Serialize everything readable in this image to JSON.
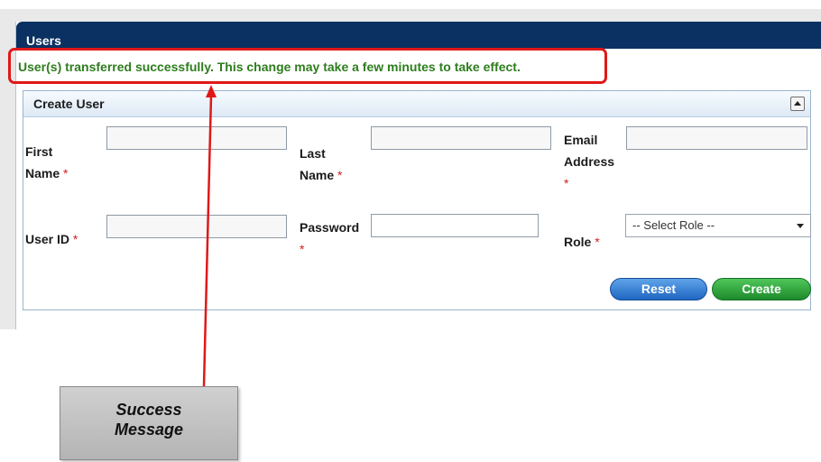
{
  "panel": {
    "title": "Users"
  },
  "message": {
    "success": "User(s) transferred successfully. This change may take a few minutes to take effect."
  },
  "section": {
    "title": "Create User"
  },
  "form": {
    "first_name_line1": "First",
    "first_name_line2": "Name",
    "last_name_line1": "Last",
    "last_name_line2": "Name",
    "email_line1": "Email",
    "email_line2": "Address",
    "user_id": "User ID",
    "password": "Password",
    "role": "Role",
    "required_marker": "*",
    "role_selected": "-- Select Role --",
    "first_name_value": "",
    "last_name_value": "",
    "email_value": "",
    "user_id_value": "",
    "password_value": ""
  },
  "buttons": {
    "reset": "Reset",
    "create": "Create"
  },
  "annotation": {
    "text": "Success\nMessage",
    "color": "#e01818"
  },
  "icons": {
    "collapse": "chevron-up-icon",
    "dropdown": "chevron-down-icon"
  }
}
